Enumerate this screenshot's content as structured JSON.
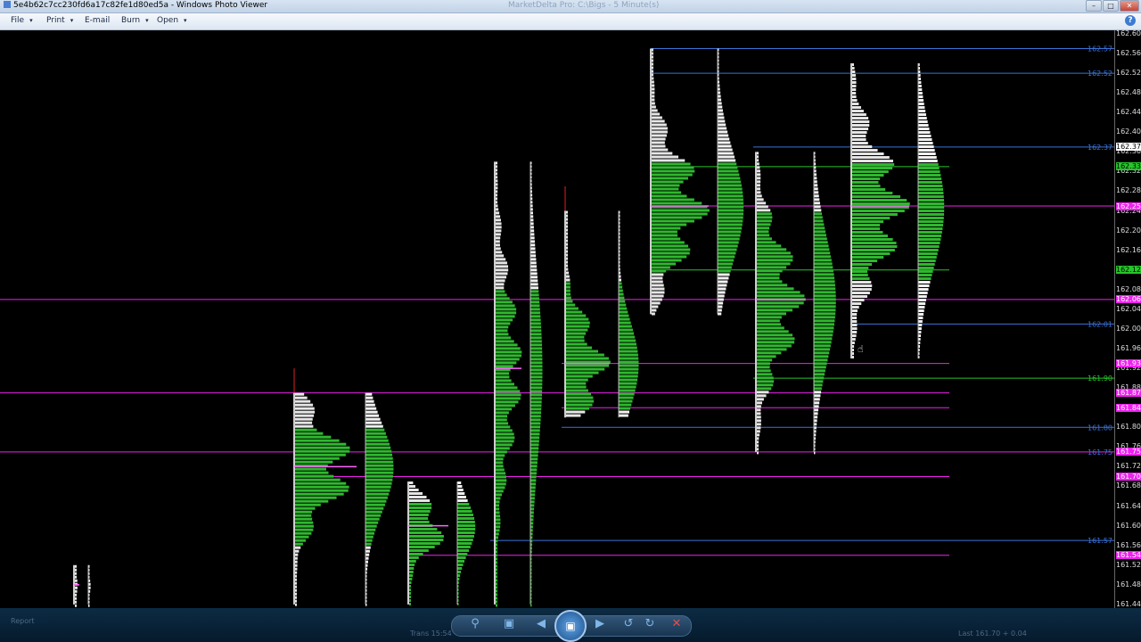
{
  "window": {
    "title": "5e4b62c7cc230fd6a17c82fe1d80ed5a - Windows Photo Viewer",
    "faded_title": "MarketDelta Pro: C:\\Bigs - 5 Minute(s)",
    "minimize": "–",
    "maximize": "□",
    "close": "✕"
  },
  "menu": {
    "items": [
      {
        "label": "File",
        "has_caret": true
      },
      {
        "label": "Print",
        "has_caret": true
      },
      {
        "label": "E-mail",
        "has_caret": false
      },
      {
        "label": "Burn",
        "has_caret": true
      },
      {
        "label": "Open",
        "has_caret": true
      }
    ],
    "caret": "▾",
    "help": "?"
  },
  "price_axis": {
    "ticks": [
      "162.60",
      "162.56",
      "162.52",
      "162.48",
      "162.44",
      "162.40",
      "162.36",
      "162.32",
      "162.28",
      "162.24",
      "162.20",
      "162.16",
      "162.12",
      "162.08",
      "162.04",
      "162.00",
      "161.96",
      "161.92",
      "161.88",
      "161.84",
      "161.80",
      "161.76",
      "161.72",
      "161.68",
      "161.64",
      "161.60",
      "161.56",
      "161.52",
      "161.48",
      "161.44"
    ],
    "highlights": [
      {
        "label": "162.37",
        "color": "#ffffff",
        "text": "#000000"
      },
      {
        "label": "162.33",
        "color": "#27c42a",
        "text": "#000000"
      },
      {
        "label": "162.25",
        "color": "#ee22ee",
        "text": "#ffffff"
      },
      {
        "label": "162.12",
        "color": "#27c42a",
        "text": "#000000"
      },
      {
        "label": "162.06",
        "color": "#ee22ee",
        "text": "#ffffff"
      },
      {
        "label": "161.93",
        "color": "#ee22ee",
        "text": "#ffffff"
      },
      {
        "label": "161.87",
        "color": "#ee22ee",
        "text": "#ffffff"
      },
      {
        "label": "161.84",
        "color": "#ee22ee",
        "text": "#ffffff"
      },
      {
        "label": "161.75",
        "color": "#ee22ee",
        "text": "#ffffff"
      },
      {
        "label": "161.70",
        "color": "#ee22ee",
        "text": "#ffffff"
      },
      {
        "label": "161.54",
        "color": "#ee22ee",
        "text": "#ffffff"
      }
    ]
  },
  "levels": [
    {
      "label": "162.57",
      "color": "#3b73d8"
    },
    {
      "label": "162.52",
      "color": "#3b73d8"
    },
    {
      "label": "162.37",
      "color": "#3b73d8"
    },
    {
      "label": "162.01",
      "color": "#3b73d8"
    },
    {
      "label": "161.90",
      "color": "#27c42a"
    },
    {
      "label": "161.80",
      "color": "#3b73d8"
    },
    {
      "label": "161.75",
      "color": "#3b73d8"
    },
    {
      "label": "161.57",
      "color": "#3b73d8"
    }
  ],
  "taskbar": {
    "zoom": "⚲",
    "fit": "▣",
    "previous": "◀",
    "slideshow": "▣",
    "next": "▶",
    "rotate_left": "↺",
    "rotate_right": "↻",
    "delete": "✕",
    "faded_left": "Report",
    "faded_mid": "Trans 15:54",
    "faded_right": "Last 161.70 + 0.04"
  },
  "colors": {
    "accent_green": "#27c42a",
    "accent_magenta": "#ee22ee",
    "accent_blue": "#3b73d8"
  }
}
